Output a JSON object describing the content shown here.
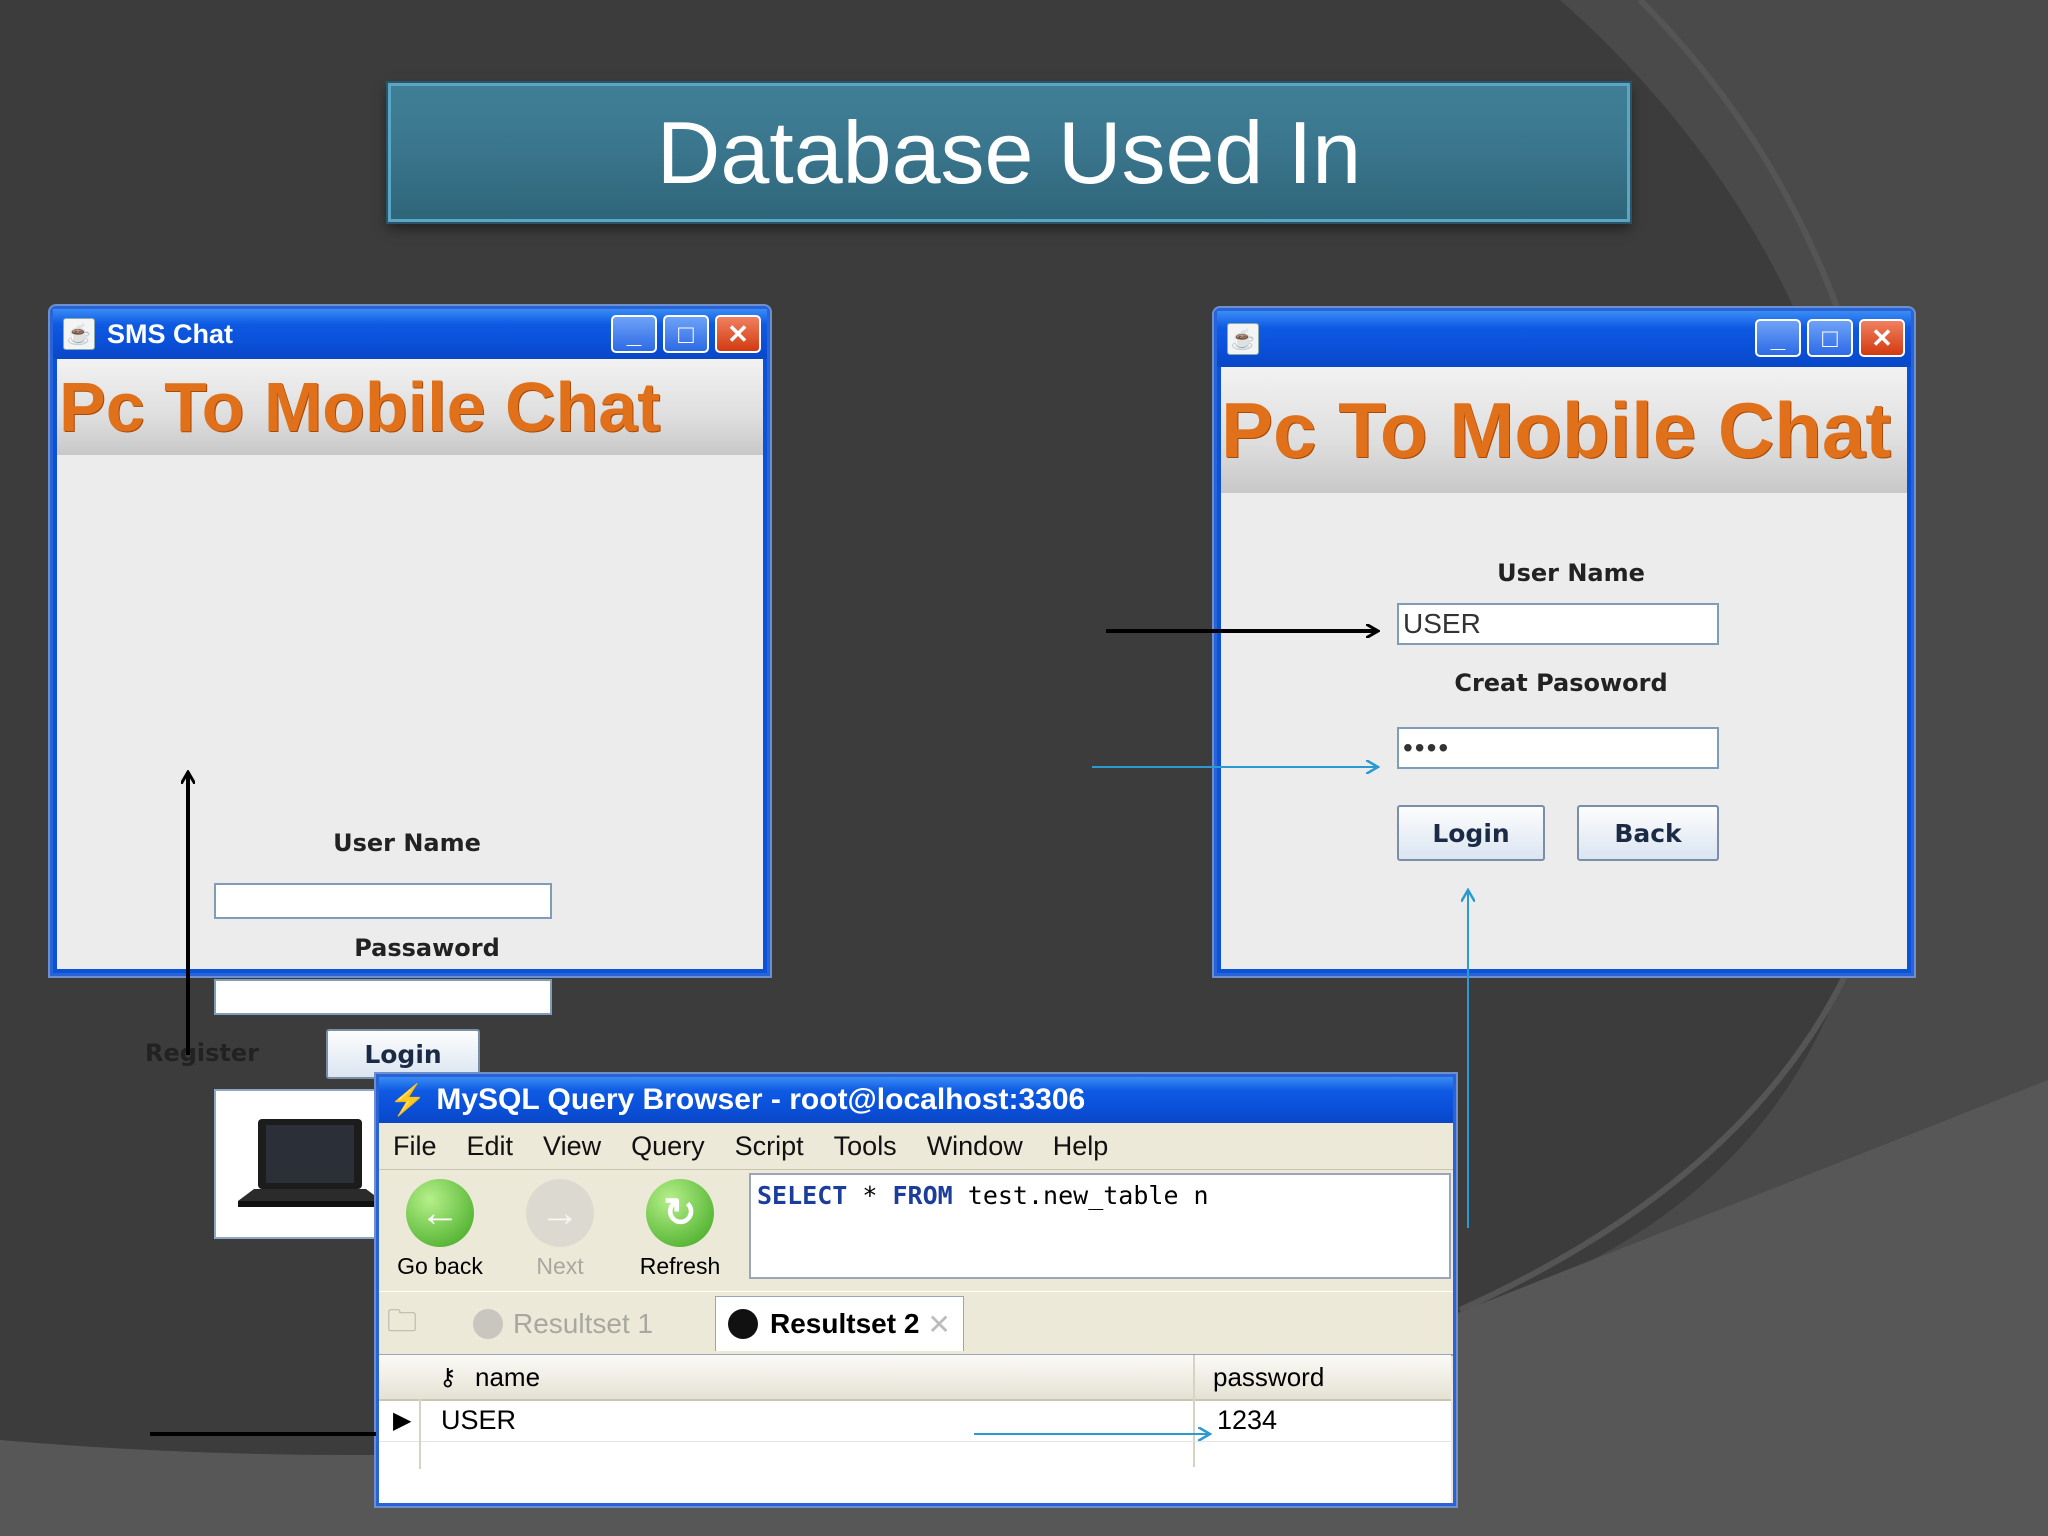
{
  "slide": {
    "title": "Database Used In"
  },
  "window_left": {
    "title": "SMS Chat",
    "banner": "Pc To Mobile Chat",
    "username_label": "User Name",
    "username_value": "",
    "password_label": "Passaword",
    "password_value": "",
    "register_label": "Register",
    "login_label": "Login"
  },
  "window_right": {
    "title": "",
    "banner": "Pc To Mobile Chat",
    "username_label": "User Name",
    "username_value": "USER",
    "password_label": "Creat Pasoword",
    "password_value": "••••",
    "login_label": "Login",
    "back_label": "Back"
  },
  "window_controls": {
    "minimize": "_",
    "maximize": "□",
    "close": "✕"
  },
  "mysql": {
    "title": "MySQL Query Browser - root@localhost:3306",
    "menu": [
      "File",
      "Edit",
      "View",
      "Query",
      "Script",
      "Tools",
      "Window",
      "Help"
    ],
    "toolbar": {
      "go_back": "Go back",
      "next": "Next",
      "refresh": "Refresh"
    },
    "query": {
      "kw_select": "SELECT",
      "star": "*",
      "kw_from": "FROM",
      "rest": "test.new_table n"
    },
    "tabs": {
      "resultset1": "Resultset 1",
      "resultset2": "Resultset 2"
    },
    "columns": {
      "name": "name",
      "password": "password"
    },
    "rows": [
      {
        "name": "USER",
        "password": "1234"
      }
    ]
  },
  "icons": [
    "java-icon",
    "minimize-icon",
    "maximize-icon",
    "close-icon",
    "laptop-icon",
    "phone-icon",
    "double-arrow-icon",
    "go-back-icon",
    "next-icon",
    "refresh-icon",
    "key-icon",
    "row-pointer-icon"
  ],
  "colors": {
    "slide_bg": "#3c3c3c",
    "title_bar": "#0a53d8",
    "banner_text": "#e0701a",
    "arrow_blue": "#2a9ad0",
    "arrow_black": "#000000"
  }
}
